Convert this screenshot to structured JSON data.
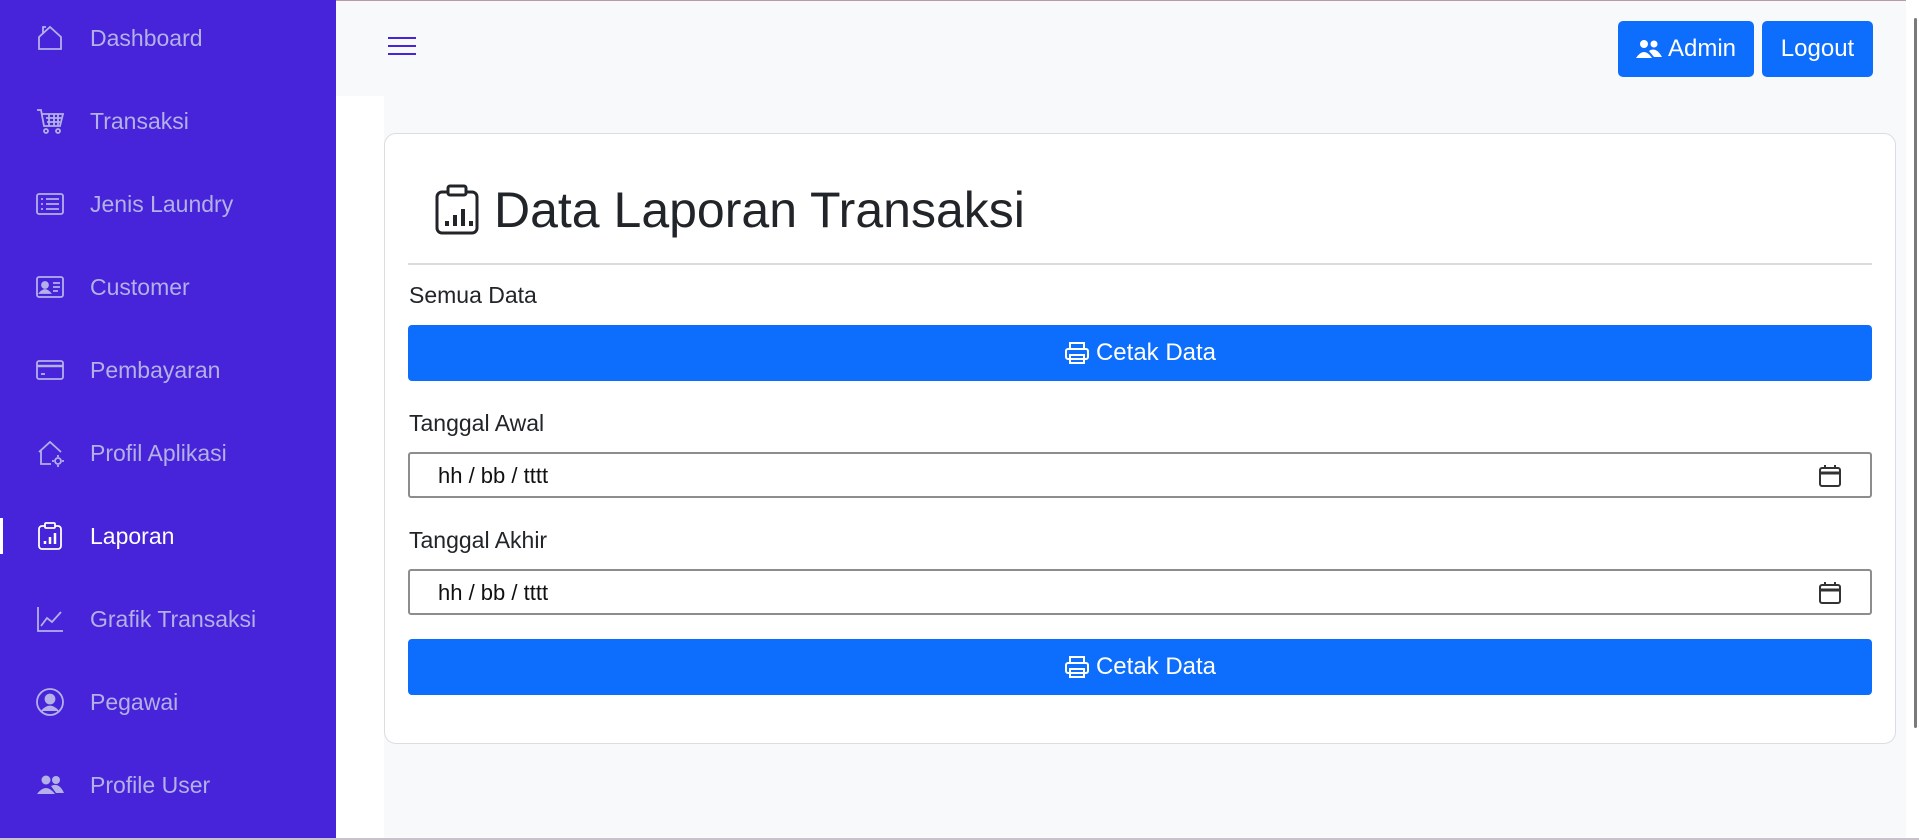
{
  "sidebar": {
    "background_color": "#4723d9",
    "items": [
      {
        "label": "Dashboard",
        "icon": "house-icon",
        "active": false
      },
      {
        "label": "Transaksi",
        "icon": "cart-icon",
        "active": false
      },
      {
        "label": "Jenis Laundry",
        "icon": "list-icon",
        "active": false
      },
      {
        "label": "Customer",
        "icon": "person-card-icon",
        "active": false
      },
      {
        "label": "Pembayaran",
        "icon": "credit-card-icon",
        "active": false
      },
      {
        "label": "Profil Aplikasi",
        "icon": "house-gear-icon",
        "active": false
      },
      {
        "label": "Laporan",
        "icon": "clipboard-chart-icon",
        "active": true
      },
      {
        "label": "Grafik Transaksi",
        "icon": "line-chart-icon",
        "active": false
      },
      {
        "label": "Pegawai",
        "icon": "person-circle-icon",
        "active": false
      },
      {
        "label": "Profile User",
        "icon": "people-icon",
        "active": false
      }
    ]
  },
  "header": {
    "menu_icon": "hamburger-icon",
    "admin_label": "Admin",
    "admin_icon": "people-fill-icon",
    "logout_label": "Logout",
    "button_color": "#0d6efd"
  },
  "main": {
    "title": "Data Laporan Transaksi",
    "title_icon": "clipboard-chart-icon",
    "all_data_label": "Semua Data",
    "print_all_label": "Cetak Data",
    "start_date_label": "Tanggal Awal",
    "start_date_placeholder": "hh / bb / tttt",
    "end_date_label": "Tanggal Akhir",
    "end_date_placeholder": "hh / bb / tttt",
    "print_range_label": "Cetak Data",
    "print_icon": "printer-icon",
    "calendar_icon": "calendar-icon"
  }
}
